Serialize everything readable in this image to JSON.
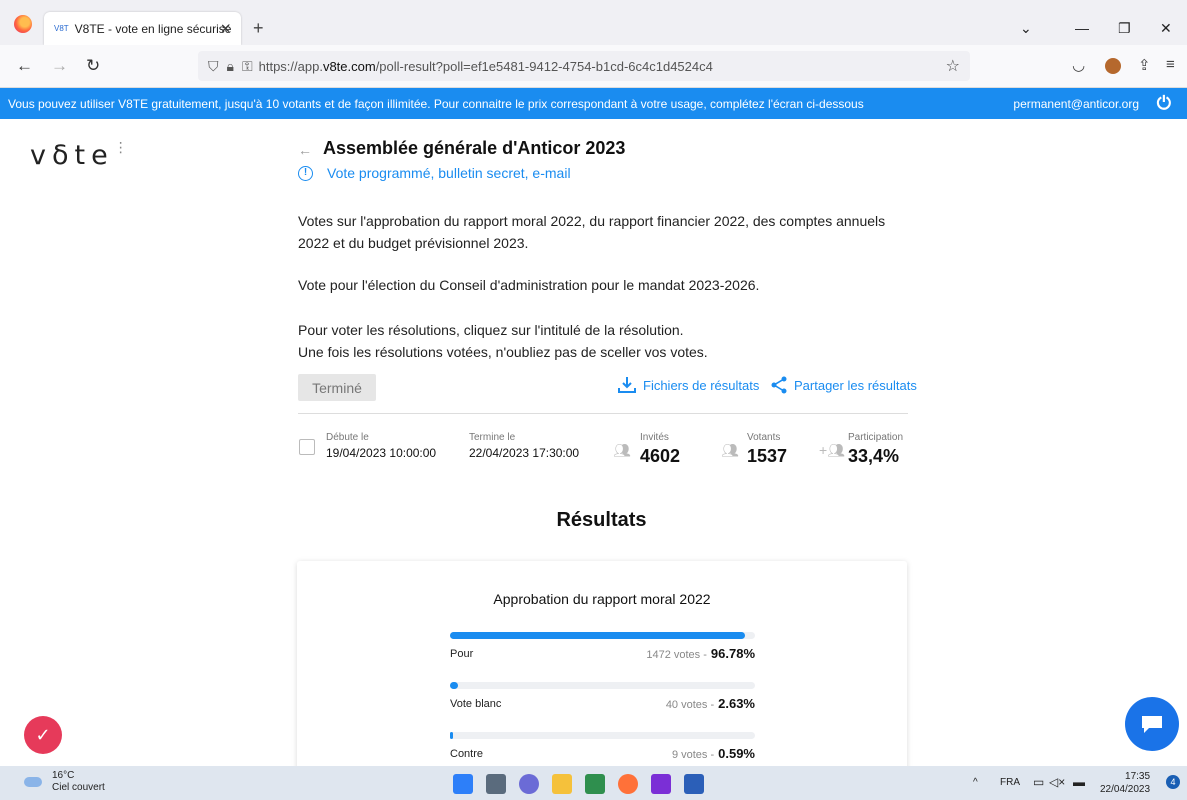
{
  "browser": {
    "tab_title": "V8TE - vote en ligne sécurisé",
    "tab_favicon": "V8T",
    "new_tab": "+",
    "url_prefix": "https://app.",
    "url_host": "v8te.com",
    "url_path": "/poll-result?poll=ef1e5481-9412-4754-b1cd-6c4c1d4524c4"
  },
  "banner": {
    "text": "Vous pouvez utiliser V8TE gratuitement, jusqu'à 10 votants et de façon illimitée. Pour connaitre le prix correspondant à votre usage, complétez l'écran ci-dessous",
    "email": "permanent@anticor.org"
  },
  "brand": {
    "logo": "v8te"
  },
  "poll": {
    "title": "Assemblée générale d'Anticor 2023",
    "subtitle": "Vote programmé, bulletin secret, e-mail",
    "description": [
      "Votes sur l'approbation du rapport moral 2022, du rapport financier 2022, des comptes annuels 2022 et du budget prévisionnel 2023.",
      "Vote pour l'élection du Conseil d'administration pour le mandat 2023-2026.",
      "Pour voter les résolutions, cliquez sur l'intitulé de la résolution.",
      "Une fois les résolutions votées, n'oubliez pas de sceller vos votes."
    ],
    "status_button": "Terminé",
    "files_link": "Fichiers de résultats",
    "share_link": "Partager les résultats"
  },
  "stats": {
    "start_label": "Débute le",
    "start_value": "19/04/2023 10:00:00",
    "end_label": "Termine le",
    "end_value": "22/04/2023 17:30:00",
    "invited_label": "Invités",
    "invited_value": "4602",
    "voters_label": "Votants",
    "voters_value": "1537",
    "participation_label": "Participation",
    "participation_value": "33,4%"
  },
  "results": {
    "heading": "Résultats",
    "question": "Approbation du rapport moral 2022",
    "options": [
      {
        "label": "Pour",
        "votes": "1472 votes -",
        "percent": "96.78%",
        "fraction": 0.9678
      },
      {
        "label": "Vote blanc",
        "votes": "40 votes -",
        "percent": "2.63%",
        "fraction": 0.0263
      },
      {
        "label": "Contre",
        "votes": "9 votes -",
        "percent": "0.59%",
        "fraction": 0.0059
      }
    ]
  },
  "taskbar": {
    "weather_temp": "16°C",
    "weather_text": "Ciel couvert",
    "lang": "FRA",
    "time": "17:35",
    "date": "22/04/2023",
    "notifications": "4"
  },
  "colors": {
    "accent": "#1a8cf0",
    "banner": "#1a8cf0",
    "chat": "#1a73e8",
    "badge": "#e63a5a"
  }
}
